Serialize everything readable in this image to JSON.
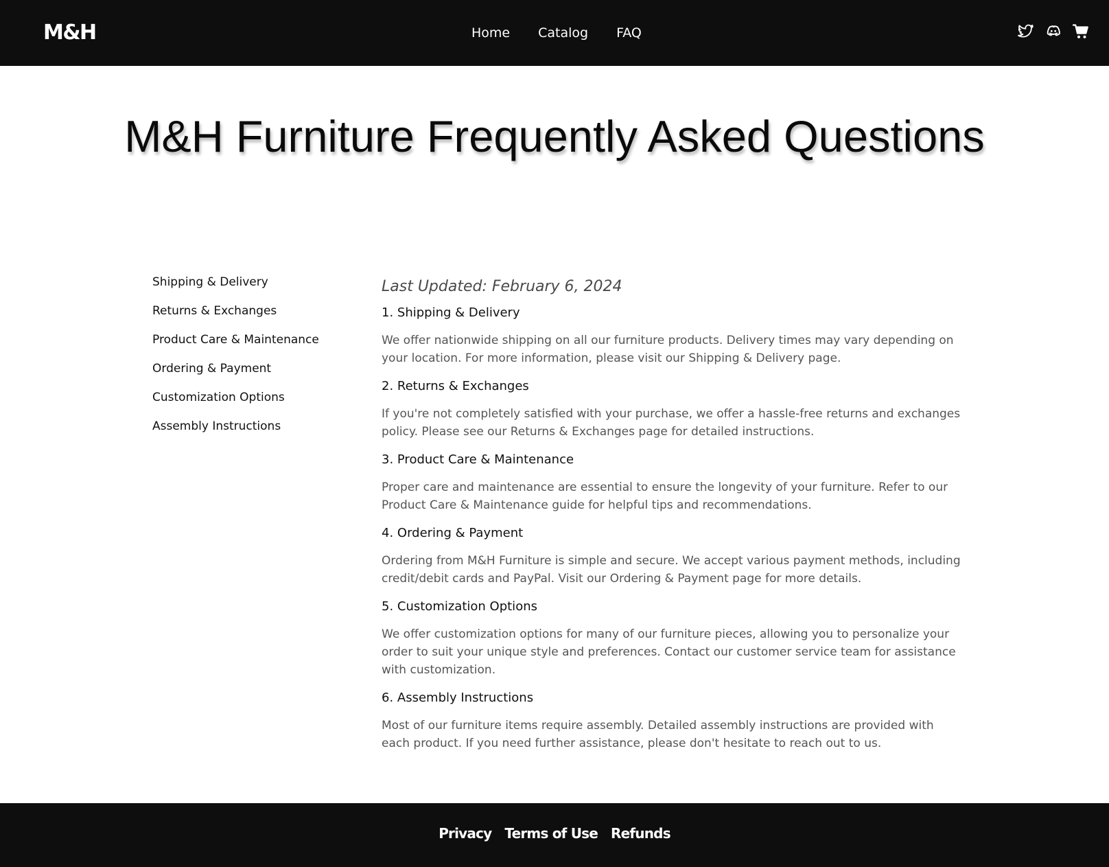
{
  "header": {
    "logo": "M&H",
    "nav": [
      {
        "label": "Home"
      },
      {
        "label": "Catalog"
      },
      {
        "label": "FAQ"
      }
    ],
    "icons": [
      "twitter-icon",
      "discord-icon",
      "cart-icon"
    ]
  },
  "page": {
    "title": "M&H Furniture Frequently Asked Questions"
  },
  "sidebar": {
    "items": [
      {
        "label": "Shipping & Delivery"
      },
      {
        "label": "Returns & Exchanges"
      },
      {
        "label": "Product Care & Maintenance"
      },
      {
        "label": "Ordering & Payment"
      },
      {
        "label": "Customization Options"
      },
      {
        "label": "Assembly Instructions"
      }
    ]
  },
  "faq": {
    "last_updated": "Last Updated: February 6, 2024",
    "sections": [
      {
        "question": "1. Shipping & Delivery",
        "answer": "We offer nationwide shipping on all our furniture products. Delivery times may vary depending on your location. For more information, please visit our Shipping & Delivery page."
      },
      {
        "question": "2. Returns & Exchanges",
        "answer": "If you're not completely satisfied with your purchase, we offer a hassle-free returns and exchanges policy. Please see our Returns & Exchanges page for detailed instructions."
      },
      {
        "question": "3. Product Care & Maintenance",
        "answer": "Proper care and maintenance are essential to ensure the longevity of your furniture. Refer to our Product Care & Maintenance guide for helpful tips and recommendations."
      },
      {
        "question": "4. Ordering & Payment",
        "answer": "Ordering from M&H Furniture is simple and secure. We accept various payment methods, including credit/debit cards and PayPal. Visit our Ordering & Payment page for more details."
      },
      {
        "question": "5. Customization Options",
        "answer": "We offer customization options for many of our furniture pieces, allowing you to personalize your order to suit your unique style and preferences. Contact our customer service team for assistance with customization."
      },
      {
        "question": "6. Assembly Instructions",
        "answer": "Most of our furniture items require assembly. Detailed assembly instructions are provided with each product. If you need further assistance, please don't hesitate to reach out to us."
      }
    ]
  },
  "footer": {
    "links": [
      {
        "label": "Privacy"
      },
      {
        "label": "Terms of Use"
      },
      {
        "label": "Refunds"
      }
    ]
  },
  "colors": {
    "header_bg": "#0e0e0e",
    "footer_bg": "#0e0e0e",
    "page_bg": "#ffffff",
    "answer_text": "#555555"
  }
}
